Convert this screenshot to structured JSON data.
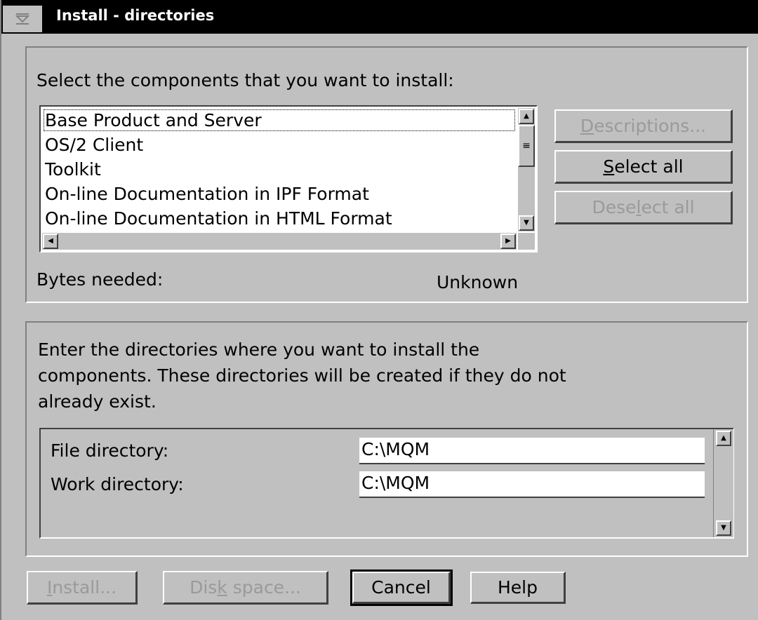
{
  "window": {
    "title": "Install - directories"
  },
  "components": {
    "prompt": "Select the components that you want to install:",
    "items": [
      {
        "label": "Base Product and Server",
        "selected": true
      },
      {
        "label": "OS/2 Client",
        "selected": false
      },
      {
        "label": "Toolkit",
        "selected": false
      },
      {
        "label": "On-line Documentation in IPF Format",
        "selected": false
      },
      {
        "label": "On-line Documentation in HTML Format",
        "selected": false
      }
    ],
    "buttons": {
      "descriptions": {
        "pre": "",
        "ul": "D",
        "post": "escriptions..."
      },
      "select_all": {
        "pre": "",
        "ul": "S",
        "post": "elect all"
      },
      "deselect_all": {
        "pre": "Dese",
        "ul": "l",
        "post": "ect all"
      }
    },
    "bytes_label": "Bytes needed:",
    "bytes_value": "Unknown"
  },
  "directories": {
    "prompt_lines": [
      "Enter the directories where you want to install the",
      "components.  These directories will be created if they do not",
      "already exist."
    ],
    "file_label": "File directory:",
    "file_value": "C:\\MQM",
    "work_label": "Work directory:",
    "work_value": "C:\\MQM"
  },
  "footer": {
    "install": {
      "pre": "",
      "ul": "I",
      "post": "nstall..."
    },
    "disk_space": {
      "pre": "Dis",
      "ul": "k",
      "post": " space..."
    },
    "cancel": "Cancel",
    "help": "Help"
  },
  "icons": {
    "system_menu": "system-menu-icon",
    "scroll_up": "up-arrow-icon",
    "scroll_down": "down-arrow-icon",
    "scroll_left": "left-arrow-icon",
    "scroll_right": "right-arrow-icon"
  },
  "colors": {
    "face": "#c0c0c0",
    "titlebar": "#000000",
    "disabled_text": "#9a9a9a"
  }
}
